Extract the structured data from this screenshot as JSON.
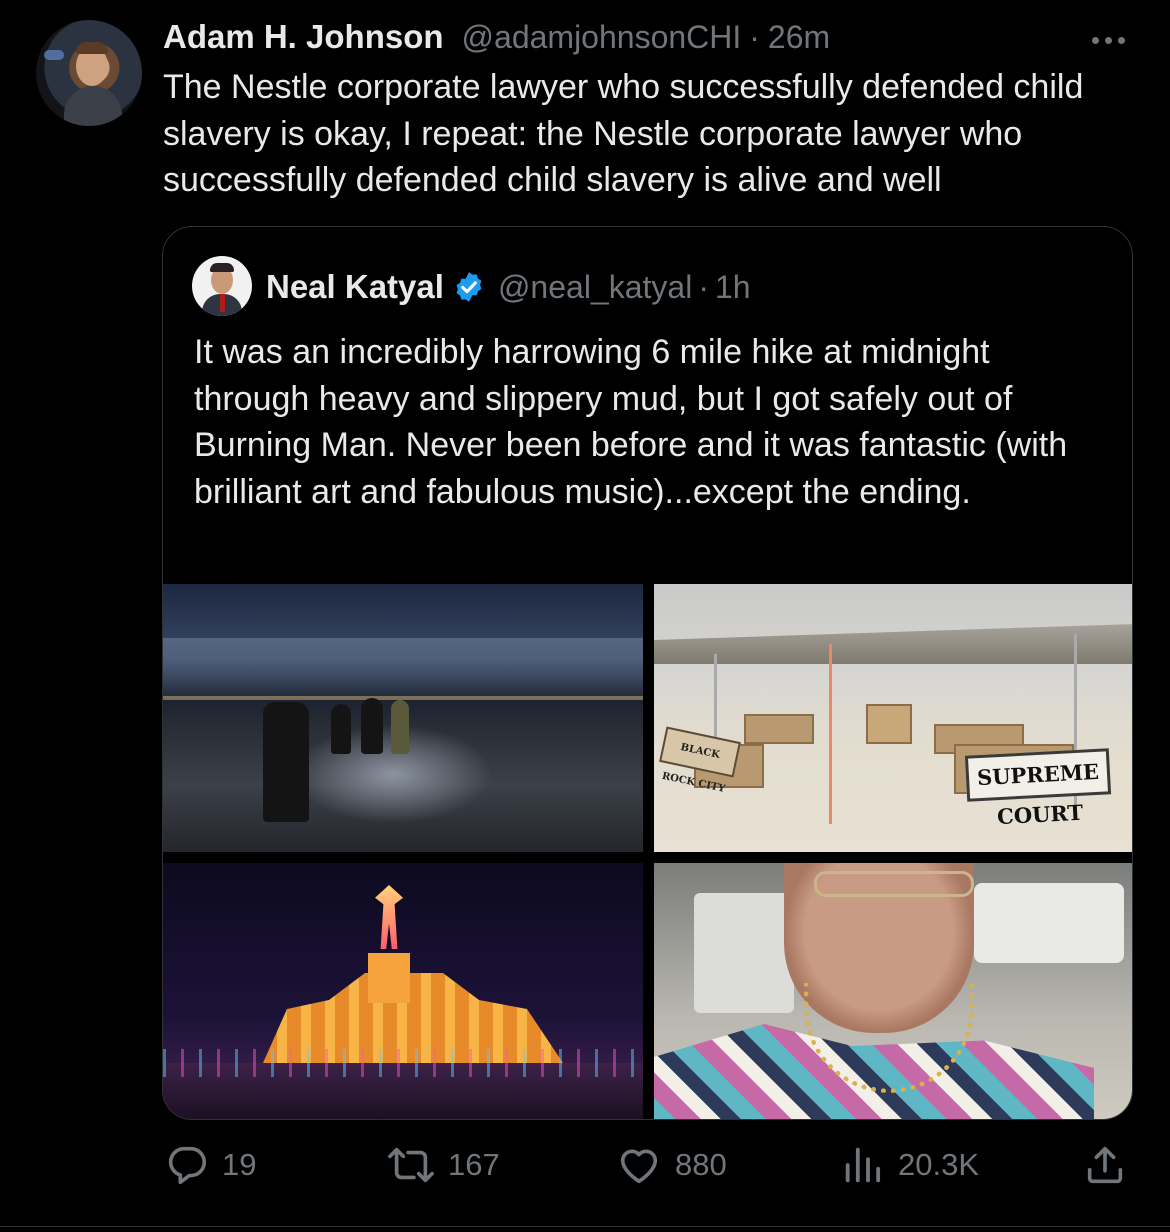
{
  "tweet": {
    "author": {
      "name": "Adam H. Johnson",
      "handle": "@adamjohnsonCHI",
      "separator": "·",
      "time": "26m"
    },
    "text": "The Nestle corporate lawyer who successfully defended child slavery is okay, I repeat: the Nestle corporate lawyer who successfully defended child slavery is alive and well",
    "more_icon": "more-horizontal-icon",
    "quote": {
      "author": {
        "name": "Neal Katyal",
        "verified": true,
        "handle": "@neal_katyal",
        "separator": "·",
        "time": "1h"
      },
      "text": "It was an incredibly harrowing 6 mile hike at midnight through heavy and slippery mud, but I got safely out of Burning Man. Never been before and it was fantastic (with brilliant art and fabulous music)...except the ending.",
      "photos": {
        "sign_supreme_court": "SUPREME COURT",
        "sign_black_rock_city": "BLACK ROCK CITY"
      }
    },
    "actions": {
      "replies": "19",
      "retweets": "167",
      "likes": "880",
      "views": "20.3K"
    },
    "colors": {
      "background": "#000000",
      "text": "#e7e9ea",
      "muted": "#71767b",
      "border": "#2f3336",
      "verified": "#1d9bf0"
    }
  }
}
